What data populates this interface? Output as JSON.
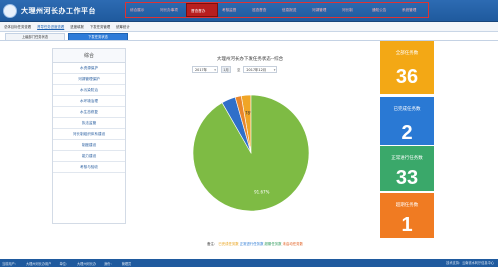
{
  "header": {
    "title": "大理州河长办工作平台",
    "nav": [
      {
        "label": "综合展示",
        "active": false
      },
      {
        "label": "河长办事项",
        "active": false
      },
      {
        "label": "督查督办",
        "active": true
      },
      {
        "label": "考核监督",
        "active": false
      },
      {
        "label": "巡查督查",
        "active": false
      },
      {
        "label": "信息报送",
        "active": false
      },
      {
        "label": "河湖管理",
        "active": false
      },
      {
        "label": "河长制",
        "active": false
      },
      {
        "label": "通知公告",
        "active": false
      },
      {
        "label": "系统管理",
        "active": false
      }
    ]
  },
  "subnav": {
    "items": [
      {
        "label": "总体目标任务查看",
        "active": false
      },
      {
        "label": "督导任务进度查看",
        "active": true
      },
      {
        "label": "进度填报",
        "active": false
      },
      {
        "label": "下发任务管理",
        "active": false
      },
      {
        "label": "统筹统计",
        "active": false
      }
    ]
  },
  "tabs": [
    {
      "label": "上级部门任务状态",
      "active": false
    },
    {
      "label": "下发任务状态",
      "active": true
    }
  ],
  "sidebar": {
    "title": "综合",
    "items": [
      "水资源保护",
      "河湖管理保护",
      "水污染防治",
      "水环境治理",
      "水生态修复",
      "执法监管",
      "河长制组织体系建设",
      "制度建设",
      "能力建设",
      "考核与验收"
    ]
  },
  "chart_panel": {
    "title": "大理州河长办下发任务状态--综合",
    "from_select": "2017年",
    "from_button": "1月",
    "separator": "至",
    "to_select": "2017年12月"
  },
  "chart_data": {
    "type": "pie",
    "title": "大理州河长办下发任务状态--综合",
    "categories": [
      "已完成",
      "正常进行",
      "超期",
      "未启动"
    ],
    "values": [
      2.7,
      91.7,
      3.9,
      1.7
    ],
    "labels": [
      "2.78%",
      "91.67%",
      "",
      ""
    ],
    "colors": [
      "#f0a526",
      "#7ebb44",
      "#2f6fc9",
      "#e8862c"
    ]
  },
  "cards": [
    {
      "label": "全部任务数",
      "value": "36",
      "color": "#f3a815"
    },
    {
      "label": "已完成任务数",
      "value": "2",
      "color": "#2a79d4"
    },
    {
      "label": "正常进行任务数",
      "value": "33",
      "color": "#3aa86a"
    },
    {
      "label": "超期任务数",
      "value": "1",
      "color": "#f07b22"
    }
  ],
  "note": {
    "prefix": "备注：",
    "items": [
      "已完成任务数",
      "正常进行任务数",
      "超期任务数",
      "未启动任务数"
    ]
  },
  "footer": {
    "items": [
      "当前用户：",
      "大理州河长办用户",
      "单位：",
      "大理州河长办",
      "身份：",
      "管理员"
    ],
    "right": "技术支持：云南省水利厅信息中心"
  }
}
